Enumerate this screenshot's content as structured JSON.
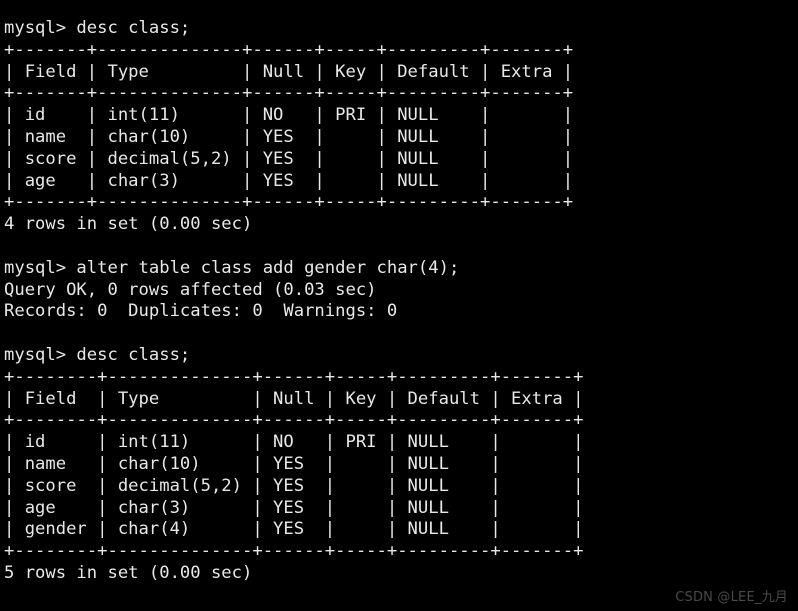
{
  "terminal": {
    "background_color": "#000000",
    "text_color": "#e8e8e8",
    "prompt": "mysql> ",
    "lines": [
      "mysql> desc class;",
      "+-------+--------------+------+-----+---------+-------+",
      "| Field | Type         | Null | Key | Default | Extra |",
      "+-------+--------------+------+-----+---------+-------+",
      "| id    | int(11)      | NO   | PRI | NULL    |       |",
      "| name  | char(10)     | YES  |     | NULL    |       |",
      "| score | decimal(5,2) | YES  |     | NULL    |       |",
      "| age   | char(3)      | YES  |     | NULL    |       |",
      "+-------+--------------+------+-----+---------+-------+",
      "4 rows in set (0.00 sec)",
      "",
      "mysql> alter table class add gender char(4);",
      "Query OK, 0 rows affected (0.03 sec)",
      "Records: 0  Duplicates: 0  Warnings: 0",
      "",
      "mysql> desc class;",
      "+--------+--------------+------+-----+---------+-------+",
      "| Field  | Type         | Null | Key | Default | Extra |",
      "+--------+--------------+------+-----+---------+-------+",
      "| id     | int(11)      | NO   | PRI | NULL    |       |",
      "| name   | char(10)     | YES  |     | NULL    |       |",
      "| score  | decimal(5,2) | YES  |     | NULL    |       |",
      "| age    | char(3)      | YES  |     | NULL    |       |",
      "| gender | char(4)      | YES  |     | NULL    |       |",
      "+--------+--------------+------+-----+---------+-------+",
      "5 rows in set (0.00 sec)"
    ],
    "commands": [
      "desc class;",
      "alter table class add gender char(4);",
      "desc class;"
    ],
    "first_result": {
      "columns": [
        "Field",
        "Type",
        "Null",
        "Key",
        "Default",
        "Extra"
      ],
      "rows": [
        [
          "id",
          "int(11)",
          "NO",
          "PRI",
          "NULL",
          ""
        ],
        [
          "name",
          "char(10)",
          "YES",
          "",
          "NULL",
          ""
        ],
        [
          "score",
          "decimal(5,2)",
          "YES",
          "",
          "NULL",
          ""
        ],
        [
          "age",
          "char(3)",
          "YES",
          "",
          "NULL",
          ""
        ]
      ],
      "status": "4 rows in set (0.00 sec)"
    },
    "alter_result": {
      "status": "Query OK, 0 rows affected (0.03 sec)",
      "details": "Records: 0  Duplicates: 0  Warnings: 0"
    },
    "second_result": {
      "columns": [
        "Field",
        "Type",
        "Null",
        "Key",
        "Default",
        "Extra"
      ],
      "rows": [
        [
          "id",
          "int(11)",
          "NO",
          "PRI",
          "NULL",
          ""
        ],
        [
          "name",
          "char(10)",
          "YES",
          "",
          "NULL",
          ""
        ],
        [
          "score",
          "decimal(5,2)",
          "YES",
          "",
          "NULL",
          ""
        ],
        [
          "age",
          "char(3)",
          "YES",
          "",
          "NULL",
          ""
        ],
        [
          "gender",
          "char(4)",
          "YES",
          "",
          "NULL",
          ""
        ]
      ],
      "status": "5 rows in set (0.00 sec)"
    }
  },
  "watermark": {
    "text": "CSDN @LEE_九月",
    "color": "#4a4a4a"
  }
}
